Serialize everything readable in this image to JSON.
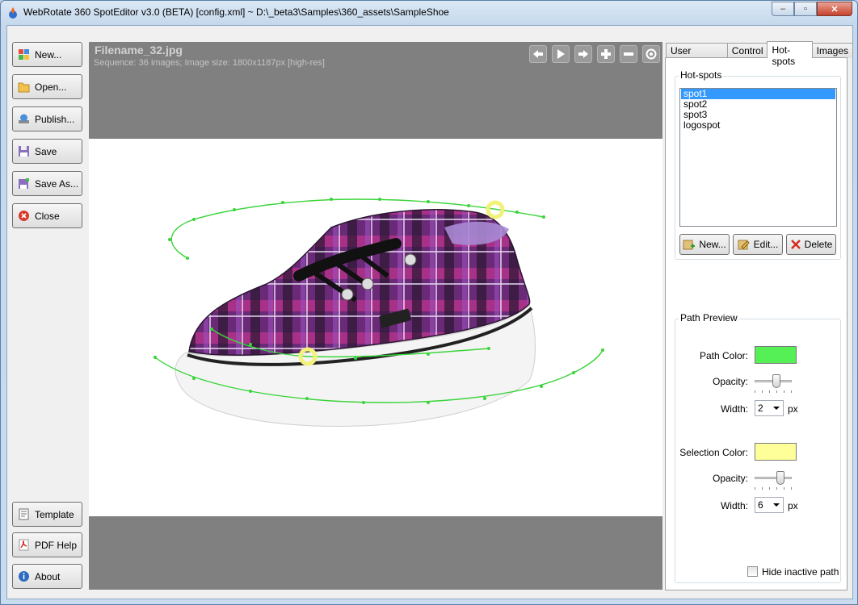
{
  "window": {
    "title": "WebRotate 360 SpotEditor v3.0 (BETA) [config.xml] ~ D:\\_beta3\\Samples\\360_assets\\SampleShoe",
    "minimize": "‒",
    "maximize": "▫",
    "close": "✕"
  },
  "sidebar": {
    "new": "New...",
    "open": "Open...",
    "publish": "Publish...",
    "save": "Save",
    "save_as": "Save As...",
    "close": "Close",
    "template": "Template",
    "pdf_help": "PDF Help",
    "about": "About"
  },
  "viewer": {
    "filename": "Filename_32.jpg",
    "info": "Sequence: 36 images; Image size: 1800x1187px [high-res]"
  },
  "tabs": [
    "User Interface",
    "Control",
    "Hot-spots",
    "Images"
  ],
  "active_tab": "Hot-spots",
  "hotspots": {
    "group_label": "Hot-spots",
    "items": [
      "spot1",
      "spot2",
      "spot3",
      "logospot"
    ],
    "selected": "spot1",
    "new_button": "New...",
    "edit_button": "Edit...",
    "delete_button": "Delete"
  },
  "path_preview": {
    "group_label": "Path Preview",
    "path_color_label": "Path Color:",
    "path_color": "#55f055",
    "opacity_label": "Opacity:",
    "width_label": "Width:",
    "path_width": "2",
    "path_opacity": 0.6,
    "unit": "px",
    "selection_color_label": "Selection Color:",
    "selection_color": "#ffff99",
    "selection_opacity": 0.75,
    "selection_width": "6",
    "hide_inactive_label": "Hide inactive path",
    "hide_inactive": false
  }
}
